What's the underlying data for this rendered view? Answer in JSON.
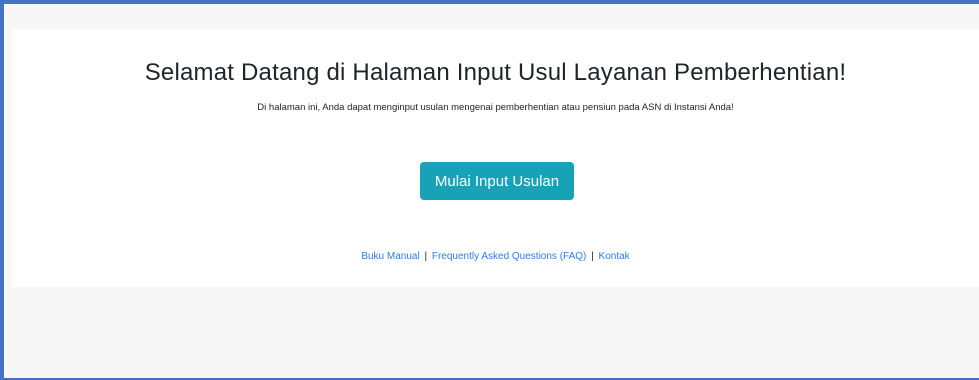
{
  "page": {
    "title": "Selamat Datang di Halaman Input Usul Layanan Pemberhentian!",
    "subtitle": "Di halaman ini, Anda dapat menginput usulan mengenai pemberhentian atau pensiun pada ASN di Instansi Anda!"
  },
  "actions": {
    "start_button_label": "Mulai Input Usulan"
  },
  "footer_links": {
    "manual": "Buku Manual",
    "faq": "Frequently Asked Questions (FAQ)",
    "contact": "Kontak",
    "separator": "|"
  },
  "colors": {
    "frame_border": "#4472c4",
    "button_bg": "#17a2b8",
    "link": "#2b7de9",
    "page_bg": "#f7f7f7",
    "card_bg": "#ffffff"
  }
}
